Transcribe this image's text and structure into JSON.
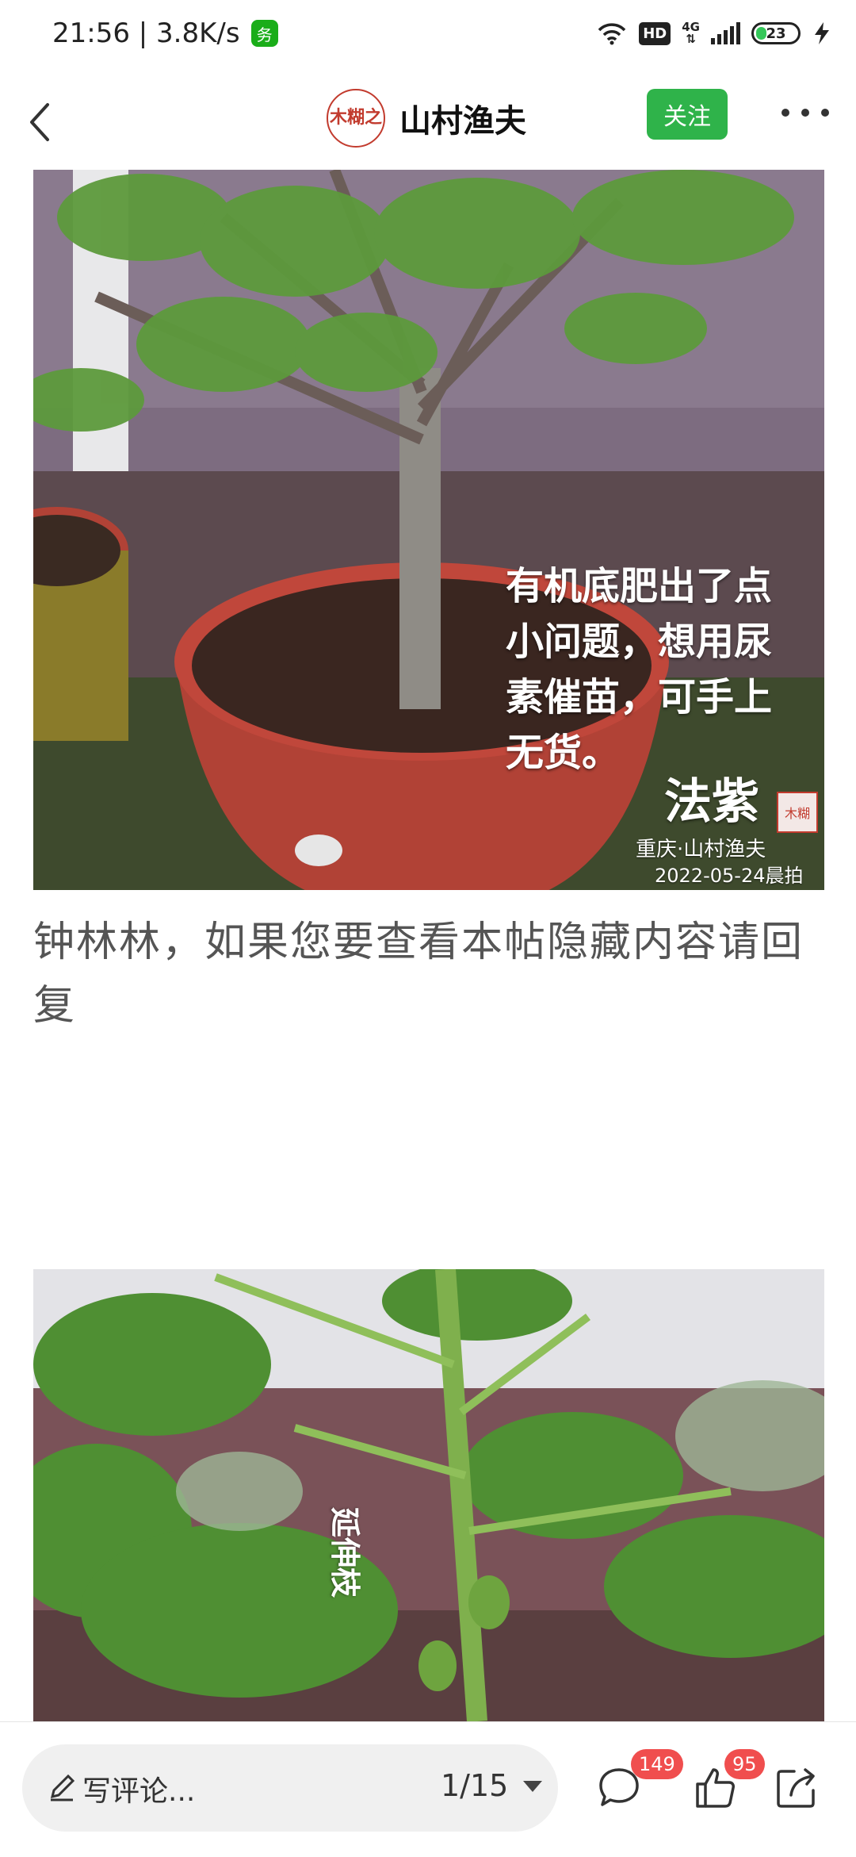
{
  "status_bar": {
    "time_speed": "21:56 | 3.8K/s",
    "app_icon_char": "务",
    "hd_label": "HD",
    "network": "4G",
    "battery": "23",
    "battery_level": 0.23
  },
  "header": {
    "seal_text": "木糊之",
    "author_name": "山村渔夫",
    "follow_label": "关注"
  },
  "photo1": {
    "caption": "有机底肥出了点\n小问题，想用尿\n素催苗，可手上\n无货。",
    "signature": "法紫",
    "seal_text": "木糊",
    "credit": "重庆·山村渔夫",
    "date": "2022-05-24晨拍"
  },
  "post_text": "钟林林，如果您要查看本帖隐藏内容请回复",
  "photo2": {
    "caption": "延伸枝"
  },
  "bottom_bar": {
    "comment_placeholder": "写评论...",
    "pager": "1/15",
    "comment_count": "149",
    "like_count": "95"
  },
  "colors": {
    "follow_green": "#2fb34a",
    "badge_red": "#f04e4e",
    "seal_red": "#c23b2e"
  }
}
